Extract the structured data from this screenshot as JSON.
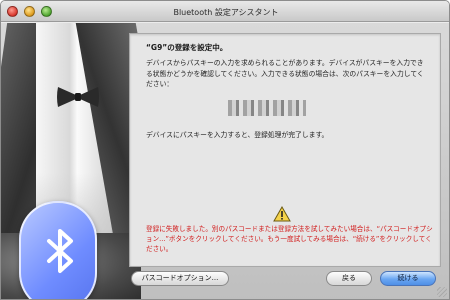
{
  "window": {
    "title": "Bluetooth 設定アシスタント"
  },
  "panel": {
    "heading": "“G9”の登録を設定中。",
    "instructions": "デバイスからパスキーの入力を求められることがあります。デバイスがパスキーを入力できる状態かどうかを確認してください。入力できる状態の場合は、次のパスキーを入力してください：",
    "passkey_hidden": "",
    "completion": "デバイスにパスキーを入力すると、登録処理が完了します。",
    "error": "登録に失敗しました。別のパスコードまたは登録方法を試してみたい場合は、“パスコードオプション...”ボタンをクリックしてください。もう一度試してみる場合は、“続ける”をクリックしてください。"
  },
  "buttons": {
    "passcode_options": "パスコードオプション...",
    "back": "戻る",
    "continue": "続ける"
  },
  "colors": {
    "error_text": "#d11a1a",
    "default_button": "#6aa6f2",
    "bluetooth_badge": "#6f8cff"
  },
  "icons": [
    "close-window-button",
    "minimize-window-button",
    "zoom-window-button",
    "warning-icon",
    "bluetooth-icon",
    "bowtie-illustration"
  ]
}
